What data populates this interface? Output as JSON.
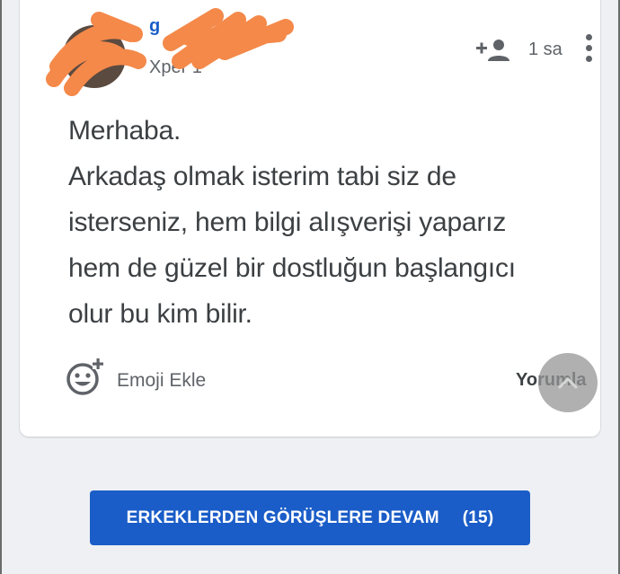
{
  "post": {
    "author": {
      "name_visible": "g",
      "level": "Xper 1"
    },
    "time": "1 sa",
    "icons": {
      "follow": "add-user-icon",
      "more": "more-vertical-icon",
      "emoji": "emoji-add-icon",
      "scroll_top": "chevron-up-icon"
    },
    "body_lines": [
      "Merhaba.",
      "Arkadaş olmak isterim tabi siz de",
      "isterseniz, hem bilgi alışverişi yaparız",
      "hem de güzel bir dostluğun başlangıcı",
      "olur bu kim bilir."
    ],
    "actions": {
      "emoji_label": "Emoji Ekle",
      "comment_label": "Yorumla"
    }
  },
  "continue_button": {
    "label": "ERKEKLERDEN GÖRÜŞLERE DEVAM",
    "count": "(15)"
  },
  "colors": {
    "accent": "#1a5dc8",
    "redaction": "#f4894a"
  }
}
